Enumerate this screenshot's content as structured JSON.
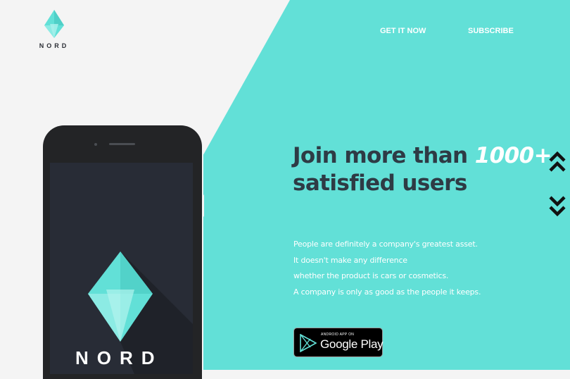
{
  "brand": {
    "name": "NORD"
  },
  "nav": {
    "items": [
      "GET IT NOW",
      "SUBSCRIBE"
    ]
  },
  "hero": {
    "headline_before": "Join more than ",
    "headline_highlight": "1000+",
    "headline_after": "satisfied users",
    "body_lines": [
      "People are definitely a company's greatest asset.",
      "It doesn't make any difference",
      "whether the product is cars or cosmetics.",
      "A company is only as good as the people it keeps."
    ]
  },
  "badge": {
    "small_text": "ANDROID APP ON",
    "main_text": "Google Play"
  },
  "phone": {
    "screen_wordmark": "NORD"
  },
  "icons": {
    "logo": "nord-diamond-logo-icon",
    "scroll_up": "double-chevron-up-icon",
    "scroll_down": "double-chevron-down-icon",
    "play": "google-play-icon"
  },
  "colors": {
    "accent": "#62e0d7",
    "background": "#f4f4f4",
    "headline": "#2e3b45",
    "phone_body": "#232426",
    "phone_screen": "#282c36"
  }
}
